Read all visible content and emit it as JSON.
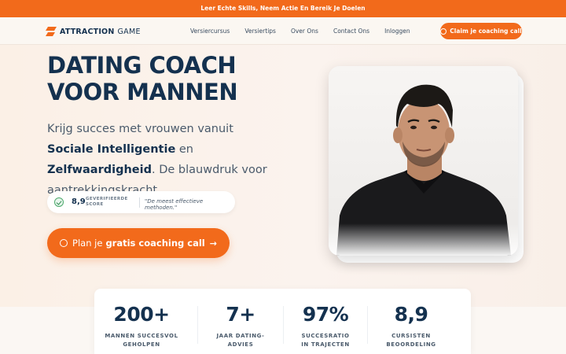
{
  "announcement": "Leer Echte Skills, Neem Actie En Bereik Je Doelen",
  "nav": {
    "logo_part1": "ATTRACTION",
    "logo_part2": "GAME",
    "links": [
      "Versiercursus",
      "Versiertips",
      "Over Ons",
      "Contact Ons",
      "Inloggen"
    ],
    "cta_label": "Claim je coaching call"
  },
  "hero": {
    "title_line1": "DATING COACH",
    "title_line2": "VOOR MANNEN",
    "lead_1": "Krijg succes met vrouwen vanuit ",
    "lead_bold1": "Sociale Intelligentie",
    "lead_2": " en ",
    "lead_bold2": "Zelfwaardigheid",
    "lead_3": ". De blauwdruk voor aantrekkingskracht.",
    "score_value": "8,9",
    "score_label": "GEVERIFIEERDE SCORE",
    "score_quote": "\"De meest effectieve methoden.\"",
    "cta_pre": "Plan je",
    "cta_bold": "gratis coaching call",
    "cta_arrow": "→"
  },
  "stats": [
    {
      "value": "200+",
      "label_line1": "MANNEN SUCCESVOL",
      "label_line2": "GEHOLPEN"
    },
    {
      "value": "7+",
      "label_line1": "JAAR DATING-",
      "label_line2": "ADVIES"
    },
    {
      "value": "97%",
      "label_line1": "SUCCESRATIO",
      "label_line2": "IN TRAJECTEN"
    },
    {
      "value": "8,9",
      "label_line1": "CURSISTEN",
      "label_line2": "BEOORDELING"
    }
  ],
  "colors": {
    "accent": "#f26a1b",
    "navy": "#14314f",
    "background": "#fbf1e9"
  }
}
